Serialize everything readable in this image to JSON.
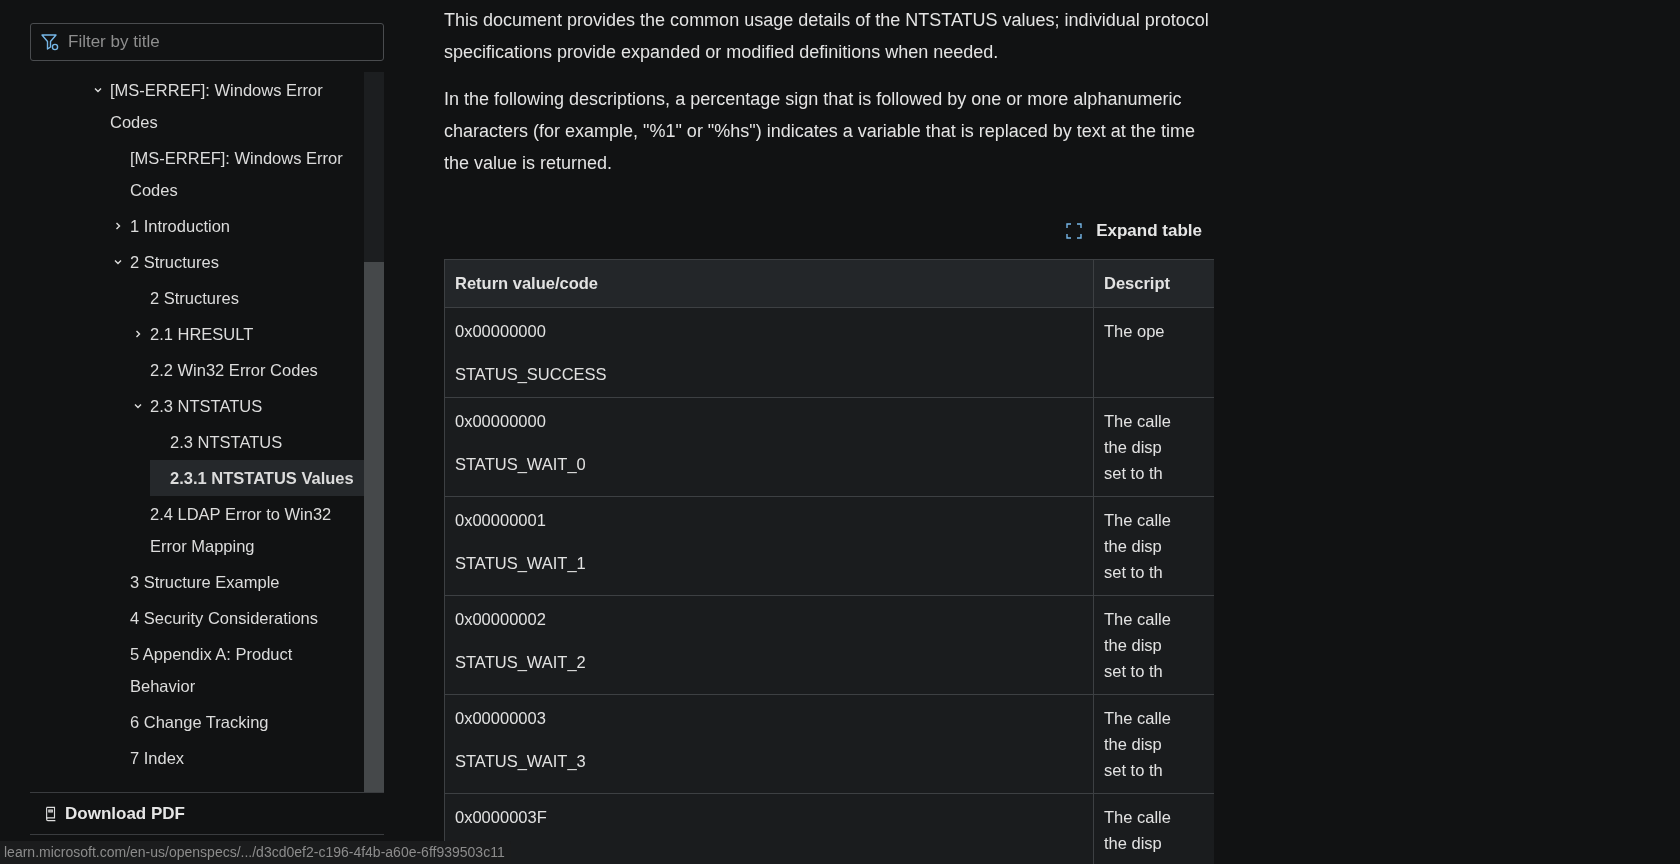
{
  "sidebar": {
    "filter": {
      "placeholder": "Filter by title"
    },
    "tree": [
      {
        "label": "[MS-ERREF]: Windows Error Codes",
        "expanded": true,
        "selected": false,
        "children": [
          {
            "label": "[MS-ERREF]: Windows Error Codes",
            "selected": false
          },
          {
            "label": "1 Introduction",
            "expanded": false,
            "selected": false
          },
          {
            "label": "2 Structures",
            "expanded": true,
            "selected": false,
            "children": [
              {
                "label": "2 Structures",
                "selected": false
              },
              {
                "label": "2.1 HRESULT",
                "expanded": false,
                "selected": false
              },
              {
                "label": "2.2 Win32 Error Codes",
                "selected": false
              },
              {
                "label": "2.3 NTSTATUS",
                "expanded": true,
                "selected": false,
                "children": [
                  {
                    "label": "2.3 NTSTATUS",
                    "selected": false
                  },
                  {
                    "label": "2.3.1 NTSTATUS Values",
                    "selected": true
                  }
                ]
              },
              {
                "label": "2.4 LDAP Error to Win32 Error Mapping",
                "selected": false
              }
            ]
          },
          {
            "label": "3 Structure Example",
            "selected": false
          },
          {
            "label": "4 Security Considerations",
            "selected": false
          },
          {
            "label": "5 Appendix A: Product Behavior",
            "selected": false
          },
          {
            "label": "6 Change Tracking",
            "selected": false
          },
          {
            "label": "7 Index",
            "selected": false
          }
        ]
      }
    ],
    "download": "Download PDF"
  },
  "content": {
    "paragraphs": [
      "This document provides the common usage details of the NTSTATUS values; individual protocol specifications provide expanded or modified definitions when needed.",
      "In the following descriptions, a percentage sign that is followed by one or more alphanumeric characters (for example, \"%1\" or \"%hs\") indicates a variable that is replaced by text at the time the value is returned."
    ],
    "expand_button": "Expand table",
    "table": {
      "columns": [
        "Return value/code",
        "Descript"
      ],
      "rows": [
        {
          "code": "0x00000000",
          "name": "STATUS_SUCCESS",
          "description": [
            "The ope"
          ]
        },
        {
          "code": "0x00000000",
          "name": "STATUS_WAIT_0",
          "description": [
            "The calle",
            "the disp",
            "set to th"
          ]
        },
        {
          "code": "0x00000001",
          "name": "STATUS_WAIT_1",
          "description": [
            "The calle",
            "the disp",
            "set to th"
          ]
        },
        {
          "code": "0x00000002",
          "name": "STATUS_WAIT_2",
          "description": [
            "The calle",
            "the disp",
            "set to th"
          ]
        },
        {
          "code": "0x00000003",
          "name": "STATUS_WAIT_3",
          "description": [
            "The calle",
            "the disp",
            "set to th"
          ]
        },
        {
          "code": "0x0000003F",
          "description": [
            "The calle",
            "the disp"
          ]
        }
      ]
    }
  },
  "status_url": "learn.microsoft.com/en-us/openspecs/.../d3cd0ef2-c196-4f4b-a60e-6ff939503c11"
}
